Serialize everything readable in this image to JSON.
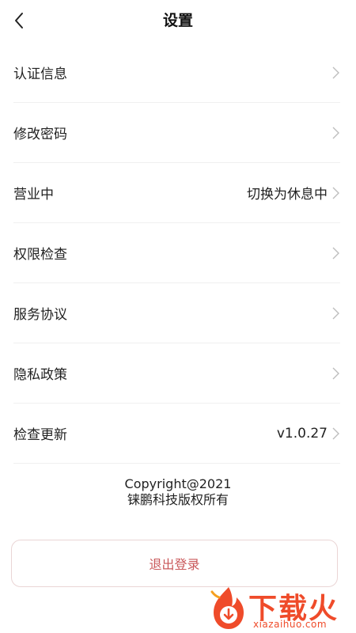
{
  "header": {
    "title": "设置",
    "back_icon": "chevron-left-icon"
  },
  "menu": [
    {
      "label": "认证信息",
      "value": ""
    },
    {
      "label": "修改密码",
      "value": ""
    },
    {
      "label": "营业中",
      "value": "切换为休息中"
    },
    {
      "label": "权限检查",
      "value": ""
    },
    {
      "label": "服务协议",
      "value": ""
    },
    {
      "label": "隐私政策",
      "value": ""
    },
    {
      "label": "检查更新",
      "value": "v1.0.27"
    }
  ],
  "footer": {
    "copyright_line1": "Copyright@2021",
    "copyright_line2": "铼鹏科技版权所有"
  },
  "logout": {
    "label": "退出登录"
  },
  "watermark": {
    "text": "下载火",
    "url": "xiazaihuo.com"
  },
  "colors": {
    "accent": "#c9585a",
    "watermark": "#ef4b2a"
  }
}
